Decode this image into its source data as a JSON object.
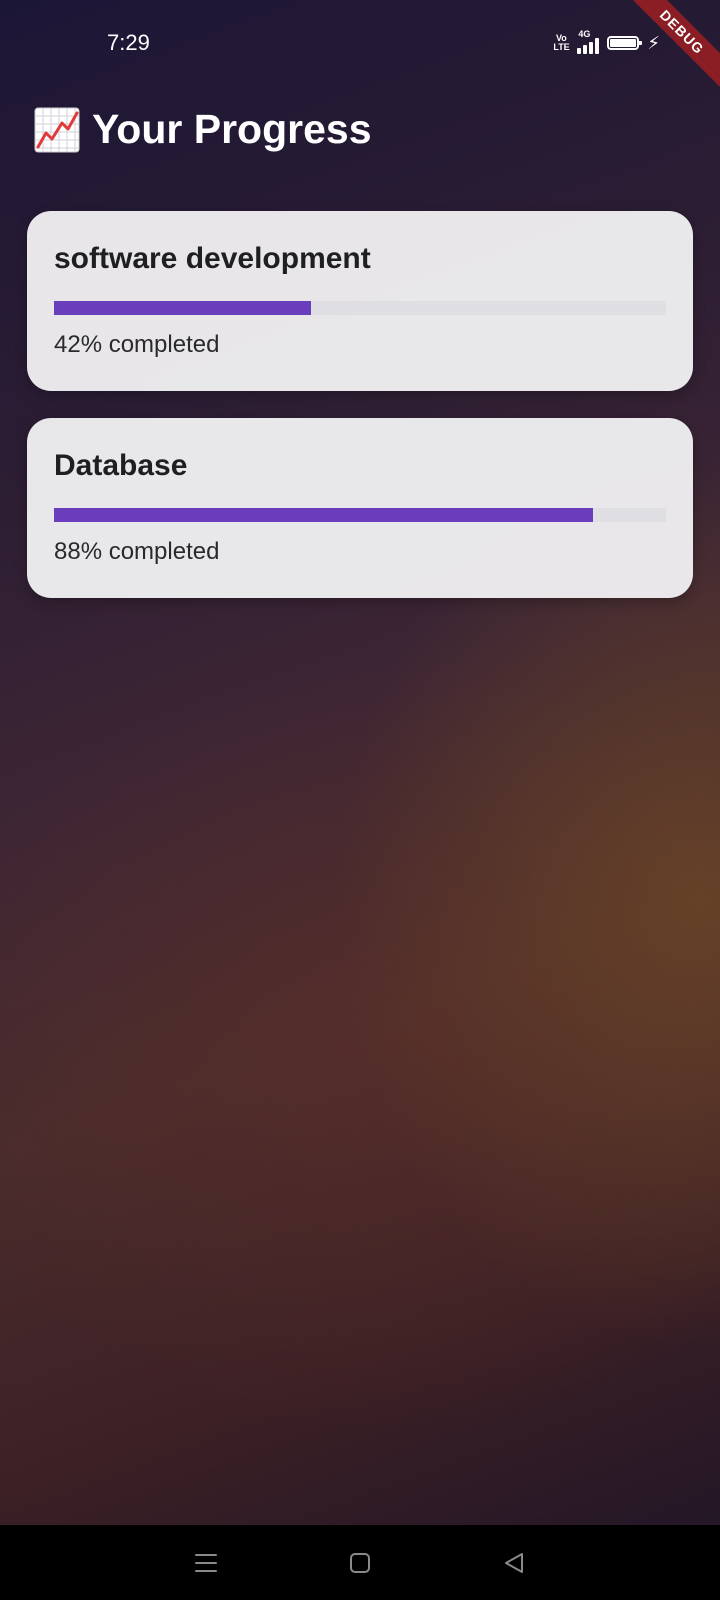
{
  "status_bar": {
    "time": "7:29",
    "volte_label": "Vo LTE",
    "network_label": "4G",
    "icons": [
      "volte-icon",
      "signal-icon",
      "battery-icon",
      "charging-icon"
    ]
  },
  "debug_banner": {
    "label": "DEBUG",
    "color": "#8b1d24"
  },
  "header": {
    "icon": "chart-increasing-icon",
    "title": "Your Progress"
  },
  "courses": [
    {
      "title": "software development",
      "progress": 0.42,
      "status_text": "42% completed"
    },
    {
      "title": "Database",
      "progress": 0.88,
      "status_text": "88% completed"
    }
  ],
  "theme": {
    "accent": "#6a3dbd",
    "card_background": "#eeedf0",
    "track": "#dfdee2"
  },
  "nav_bar": {
    "icons": [
      "menu-icon",
      "home-icon",
      "back-icon"
    ]
  }
}
